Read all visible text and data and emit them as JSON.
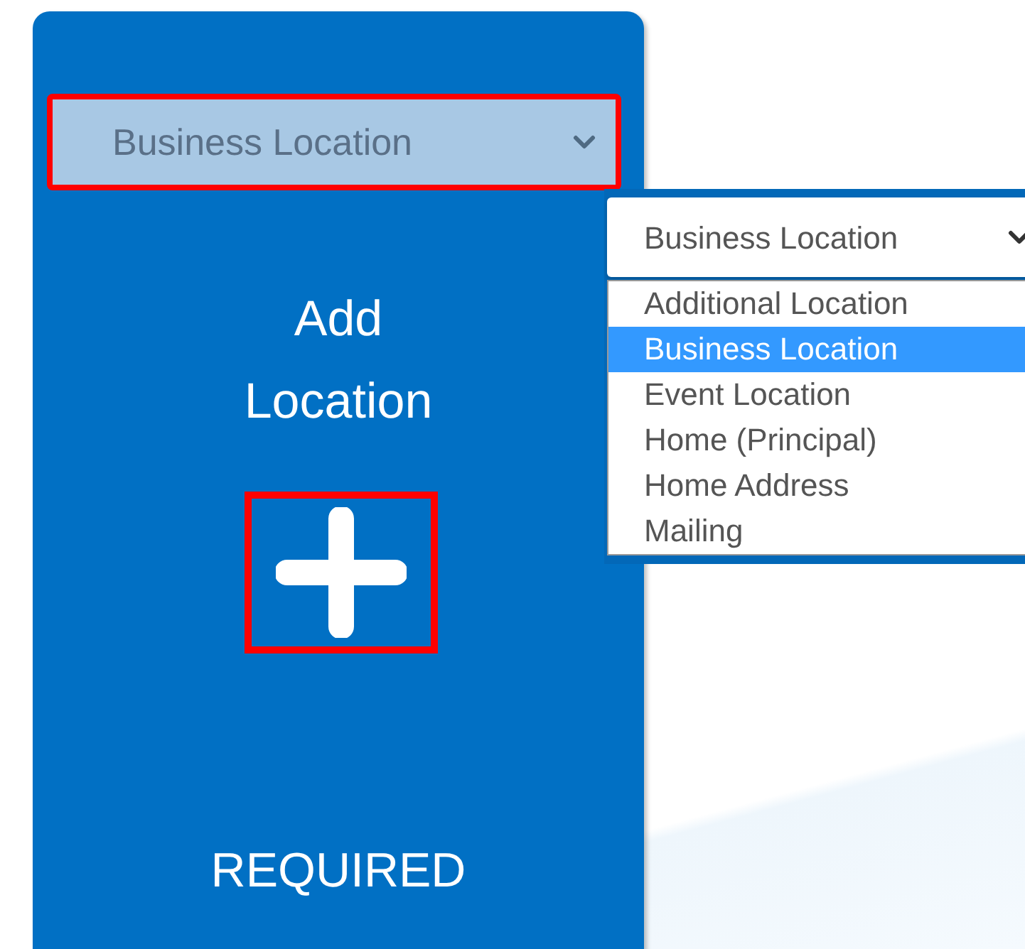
{
  "card": {
    "location_select": {
      "value": "Business Location",
      "highlighted": true
    },
    "title": "Add Location",
    "add_button": {
      "highlighted": true
    },
    "footer": "REQUIRED"
  },
  "dropdown": {
    "value": "Business Location",
    "options": [
      {
        "label": "Additional Location",
        "selected": false
      },
      {
        "label": "Business Location",
        "selected": true
      },
      {
        "label": "Event Location",
        "selected": false
      },
      {
        "label": "Home (Principal)",
        "selected": false
      },
      {
        "label": "Home Address",
        "selected": false
      },
      {
        "label": "Mailing",
        "selected": false
      }
    ]
  }
}
